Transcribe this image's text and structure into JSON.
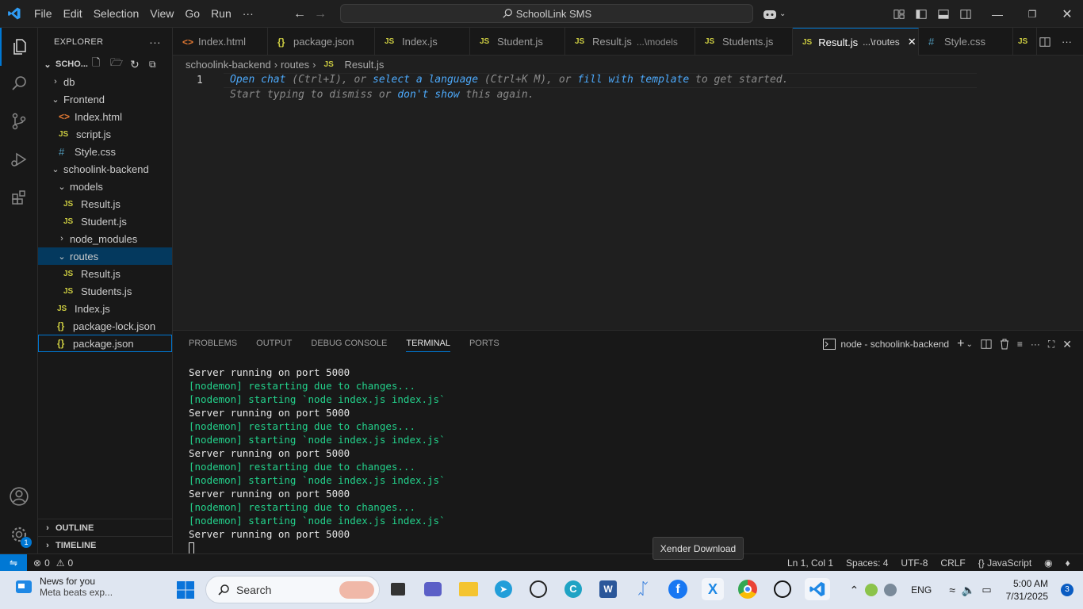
{
  "titlebar": {
    "menu": [
      "File",
      "Edit",
      "Selection",
      "View",
      "Go",
      "Run",
      "···"
    ],
    "command_center": "SchoolLink SMS"
  },
  "sidebar": {
    "header": "EXPLORER",
    "root": "SCHO...",
    "items": [
      {
        "label": "db"
      },
      {
        "label": "Frontend"
      },
      {
        "label": "Index.html"
      },
      {
        "label": "script.js"
      },
      {
        "label": "Style.css"
      },
      {
        "label": "schoolink-backend"
      },
      {
        "label": "models"
      },
      {
        "label": "Result.js"
      },
      {
        "label": "Student.js"
      },
      {
        "label": "node_modules"
      },
      {
        "label": "routes"
      },
      {
        "label": "Result.js"
      },
      {
        "label": "Students.js"
      },
      {
        "label": "Index.js"
      },
      {
        "label": "package-lock.json"
      },
      {
        "label": "package.json"
      }
    ],
    "outline": "OUTLINE",
    "timeline": "TIMELINE"
  },
  "tabs": [
    {
      "label": "Index.html"
    },
    {
      "label": "package.json"
    },
    {
      "label": "Index.js"
    },
    {
      "label": "Student.js"
    },
    {
      "label": "Result.js",
      "desc": "...\\models"
    },
    {
      "label": "Students.js"
    },
    {
      "label": "Result.js",
      "desc": "...\\routes"
    },
    {
      "label": "Style.css"
    },
    {
      "label": "JS"
    }
  ],
  "breadcrumb": {
    "a": "schoolink-backend",
    "b": "routes",
    "c": "Result.js"
  },
  "editor": {
    "line_number": "1",
    "hint1": {
      "a": "Open chat",
      "b": " (Ctrl+I), or ",
      "c": "select a language",
      "d": " (Ctrl+K M), or ",
      "e": "fill with template",
      "f": " to get started."
    },
    "hint2": {
      "a": "Start typing to dismiss or ",
      "b": "don't show",
      "c": " this again."
    }
  },
  "panel": {
    "tabs": [
      "PROBLEMS",
      "OUTPUT",
      "DEBUG CONSOLE",
      "TERMINAL",
      "PORTS"
    ],
    "terminal_name": "node - schoolink-backend",
    "lines": [
      {
        "t": "Server running on port 5000",
        "c": "w"
      },
      {
        "t": "[nodemon] restarting due to changes...",
        "c": "g"
      },
      {
        "t": "[nodemon] starting `node index.js index.js`",
        "c": "g"
      },
      {
        "t": "Server running on port 5000",
        "c": "w"
      },
      {
        "t": "[nodemon] restarting due to changes...",
        "c": "g"
      },
      {
        "t": "[nodemon] starting `node index.js index.js`",
        "c": "g"
      },
      {
        "t": "Server running on port 5000",
        "c": "w"
      },
      {
        "t": "[nodemon] restarting due to changes...",
        "c": "g"
      },
      {
        "t": "[nodemon] starting `node index.js index.js`",
        "c": "g"
      },
      {
        "t": "Server running on port 5000",
        "c": "w"
      },
      {
        "t": "[nodemon] restarting due to changes...",
        "c": "g"
      },
      {
        "t": "[nodemon] starting `node index.js index.js`",
        "c": "g"
      },
      {
        "t": "Server running on port 5000",
        "c": "w"
      }
    ]
  },
  "statusbar": {
    "errors": "0",
    "warnings": "0",
    "position": "Ln 1, Col 1",
    "spaces": "Spaces: 4",
    "encoding": "UTF-8",
    "eol": "CRLF",
    "language": "JavaScript"
  },
  "tooltip": "Xender Download",
  "taskbar": {
    "news_title": "News for you",
    "news_sub": "Meta beats exp...",
    "search": "Search",
    "lang": "ENG",
    "time": "5:00 AM",
    "date": "7/31/2025",
    "notifications": "3",
    "settings_badge": "1"
  },
  "colors": {
    "accent": "#0078d4",
    "terminal_green": "#23d18b",
    "js_yellow": "#cbcb41",
    "link_blue": "#4daafc"
  }
}
